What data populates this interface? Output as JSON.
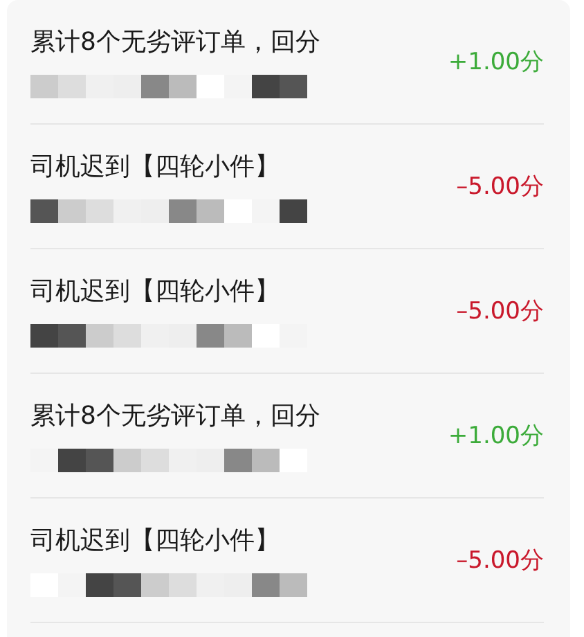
{
  "records": [
    {
      "title": "累计8个无劣评订单，回分",
      "score": "+1.00分",
      "kind": "gain"
    },
    {
      "title": "司机迟到【四轮小件】",
      "score": "–5.00分",
      "kind": "penalty"
    },
    {
      "title": "司机迟到【四轮小件】",
      "score": "–5.00分",
      "kind": "penalty"
    },
    {
      "title": "累计8个无劣评订单，回分",
      "score": "+1.00分",
      "kind": "gain"
    },
    {
      "title": "司机迟到【四轮小件】",
      "score": "–5.00分",
      "kind": "penalty"
    }
  ]
}
